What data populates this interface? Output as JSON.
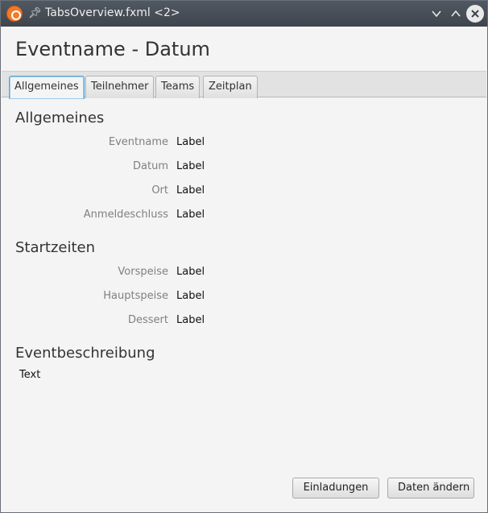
{
  "window": {
    "title": "TabsOverview.fxml <2>",
    "icons": {
      "app": "ubuntu-logo-icon",
      "pin": "pin-icon",
      "minimize": "chevron-down-icon",
      "maximize": "chevron-up-icon",
      "close": "close-icon"
    }
  },
  "header": {
    "title": "Eventname - Datum"
  },
  "tabs": [
    {
      "label": "Allgemeines",
      "active": true
    },
    {
      "label": "Teilnehmer",
      "active": false
    },
    {
      "label": "Teams",
      "active": false
    },
    {
      "label": "Zeitplan",
      "active": false
    }
  ],
  "general": {
    "title": "Allgemeines",
    "fields": [
      {
        "label": "Eventname",
        "value": "Label"
      },
      {
        "label": "Datum",
        "value": "Label"
      },
      {
        "label": "Ort",
        "value": "Label"
      },
      {
        "label": "Anmeldeschluss",
        "value": "Label"
      }
    ]
  },
  "start_times": {
    "title": "Startzeiten",
    "fields": [
      {
        "label": "Vorspeise",
        "value": "Label"
      },
      {
        "label": "Hauptspeise",
        "value": "Label"
      },
      {
        "label": "Dessert",
        "value": "Label"
      }
    ]
  },
  "description": {
    "title": "Eventbeschreibung",
    "text": "Text"
  },
  "actions": {
    "invitations": "Einladungen",
    "edit": "Daten ändern"
  },
  "colors": {
    "accent": "#5ba6d8",
    "titlebar": "#464d55",
    "background": "#f4f4f4"
  }
}
